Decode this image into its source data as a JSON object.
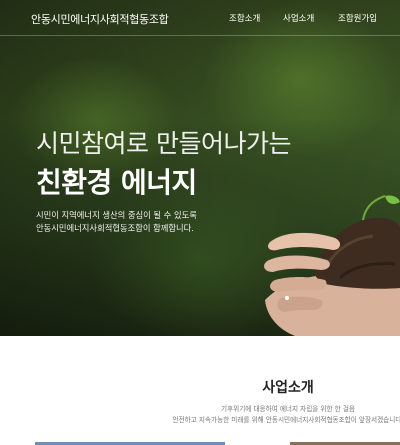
{
  "header": {
    "logo": "안동시민에너지사회적협동조합",
    "nav": [
      "조합소개",
      "사업소개",
      "조합원가입"
    ]
  },
  "hero": {
    "headline_line1": "시민참여로 만들어나가는",
    "headline_line2": "친환경 에너지",
    "description_line1": "시민이 지역에너지 생산의 중심이 될 수 있도록",
    "description_line2": "안동시민에너지사회적협동조합이 함께합니다."
  },
  "section": {
    "title": "사업소개",
    "subtitle_line1": "기후위기에 대응하여 에너지 자립을 위한 한 걸음",
    "subtitle_line2": "안전하고 지속가능한 미래를 위해 안동시민에너지사회적협동조합이 앞장서겠습니다."
  },
  "colors": {
    "hero_green": "#3f5a26",
    "text_white": "#ffffff",
    "section_title": "#222222"
  }
}
